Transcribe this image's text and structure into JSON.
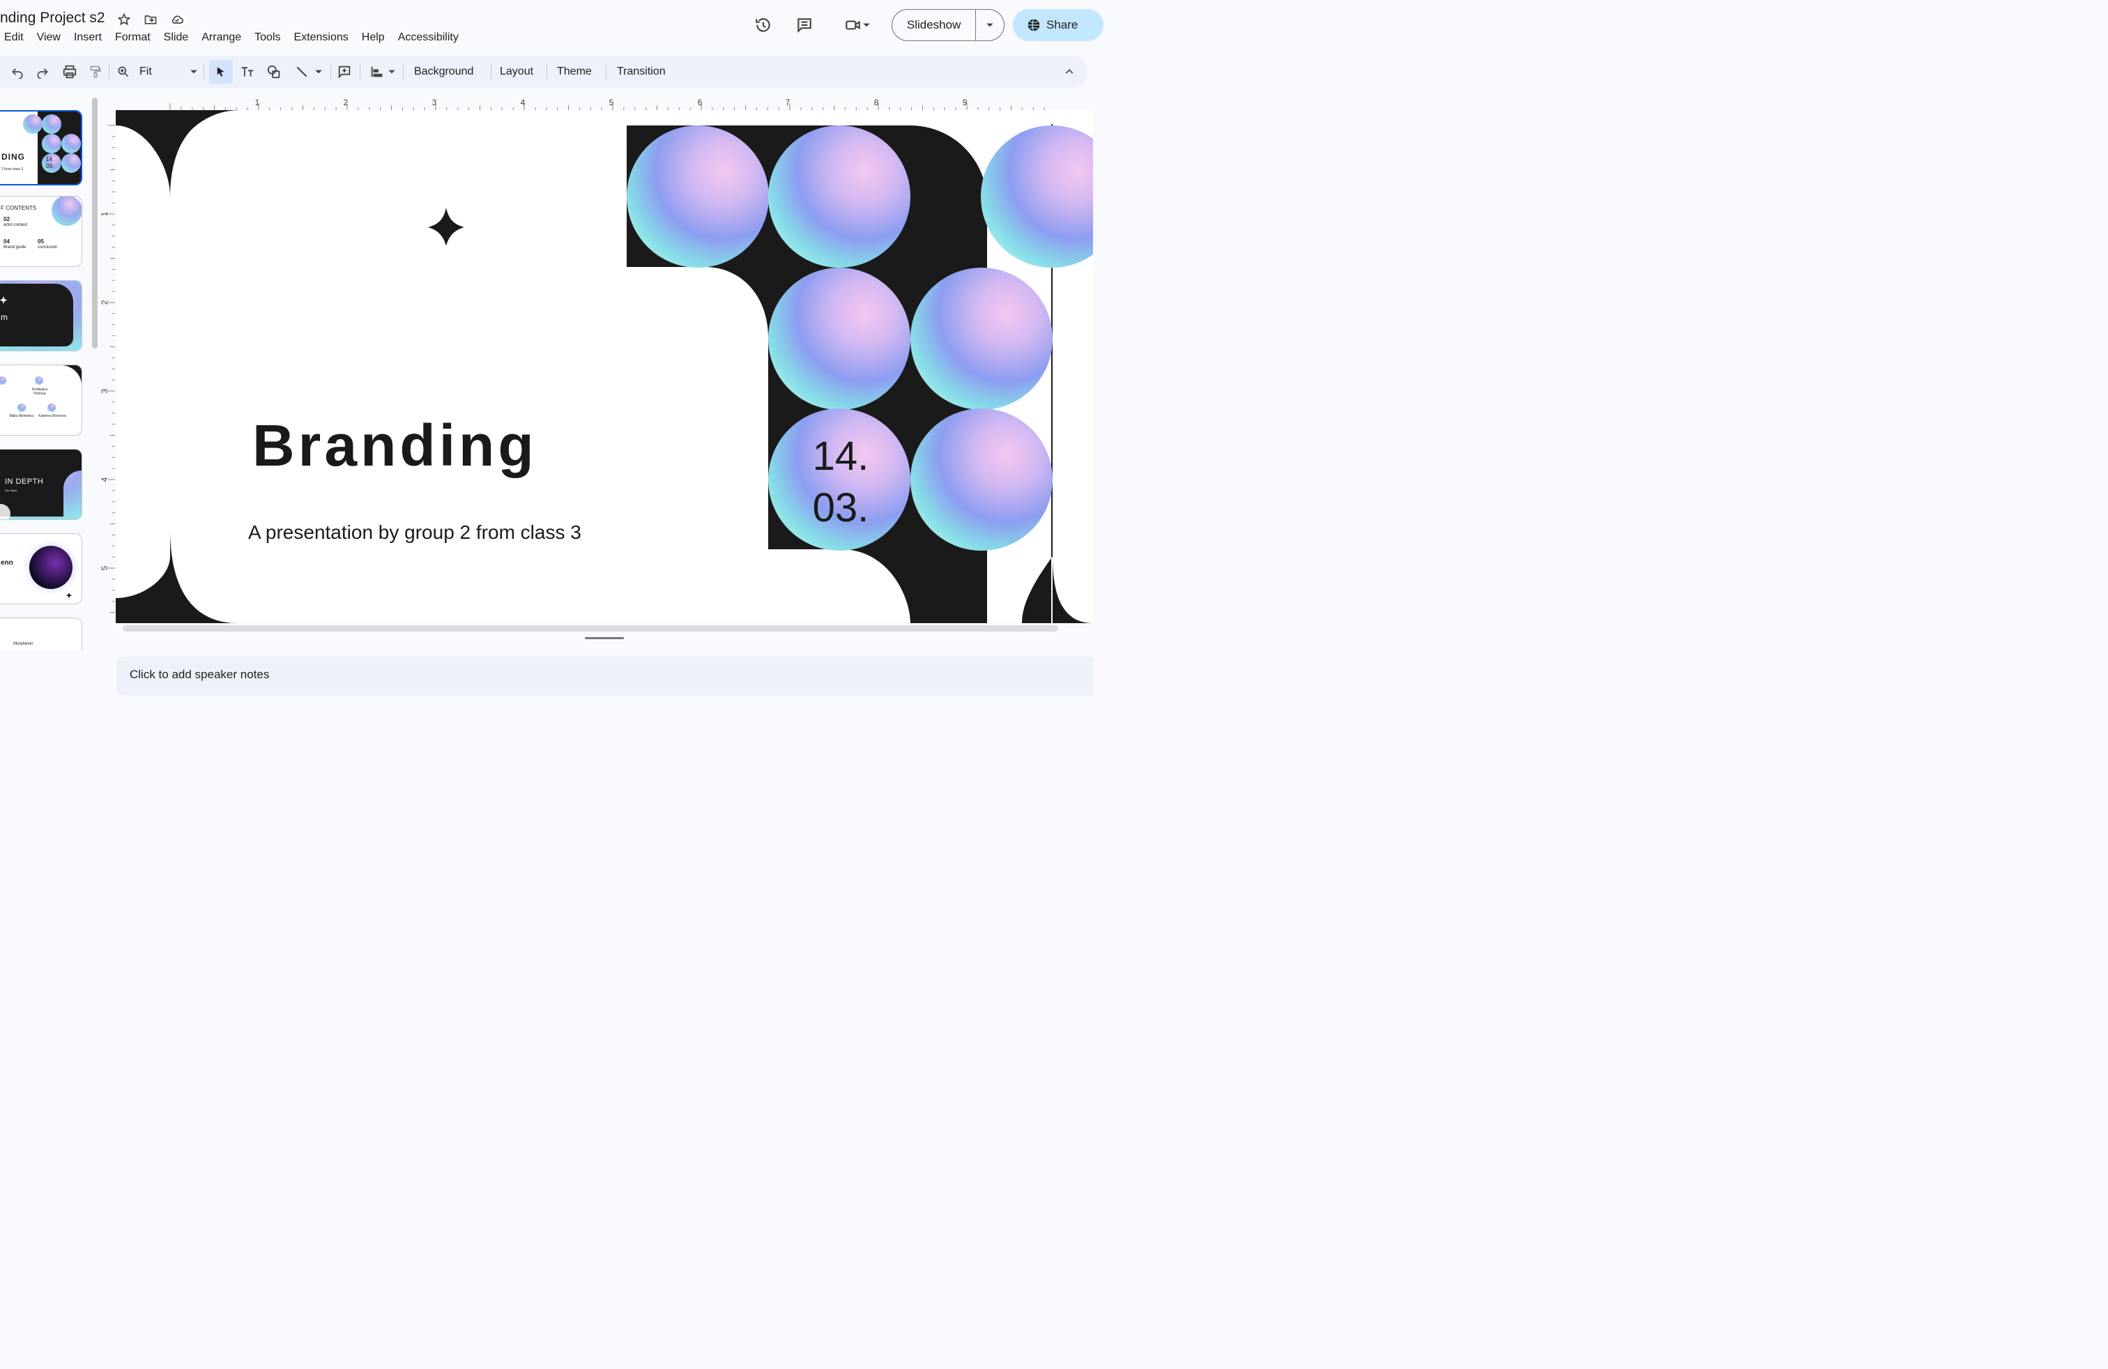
{
  "header": {
    "title": "nding Project s2",
    "menu": [
      "Edit",
      "View",
      "Insert",
      "Format",
      "Slide",
      "Arrange",
      "Tools",
      "Extensions",
      "Help",
      "Accessibility"
    ],
    "slideshow_label": "Slideshow",
    "share_label": "Share"
  },
  "toolbar": {
    "zoom": "Fit",
    "background": "Background",
    "layout": "Layout",
    "theme": "Theme",
    "transition": "Transition"
  },
  "ruler": {
    "horizontal": [
      "1",
      "2",
      "3",
      "4",
      "5",
      "6",
      "7",
      "8",
      "9"
    ],
    "vertical": [
      "1",
      "2",
      "3",
      "4",
      "5"
    ]
  },
  "slide": {
    "title": "Branding",
    "subtitle": "A presentation by group 2 from class 3",
    "date_line1": "14.",
    "date_line2": "03."
  },
  "thumbnails": [
    {
      "title": "DING",
      "date": "14.\n03.",
      "caption": "2 from class 3"
    },
    {
      "title": "F CONTENTS",
      "n1": "02",
      "t1": "artist context",
      "n2": "04",
      "t2": "Brand guide",
      "n3": "05",
      "t3": "conclusion"
    },
    {
      "title": "m"
    },
    {
      "name1": "Kristiyana Petrova",
      "name2": "Maks Mistewicz",
      "name3": "Katerina Borisova"
    },
    {
      "title": "IN DEPTH",
      "caption": "Our client"
    },
    {
      "title": "enn"
    },
    {
      "title": "Morpheinn"
    }
  ],
  "notes": {
    "placeholder": "Click to add speaker notes"
  },
  "colors": {
    "accent_blue": "#0b57d0",
    "share_bg": "#c2e7ff",
    "toolbar_bg": "#edf2fa",
    "slide_black": "#1a1a1a"
  }
}
